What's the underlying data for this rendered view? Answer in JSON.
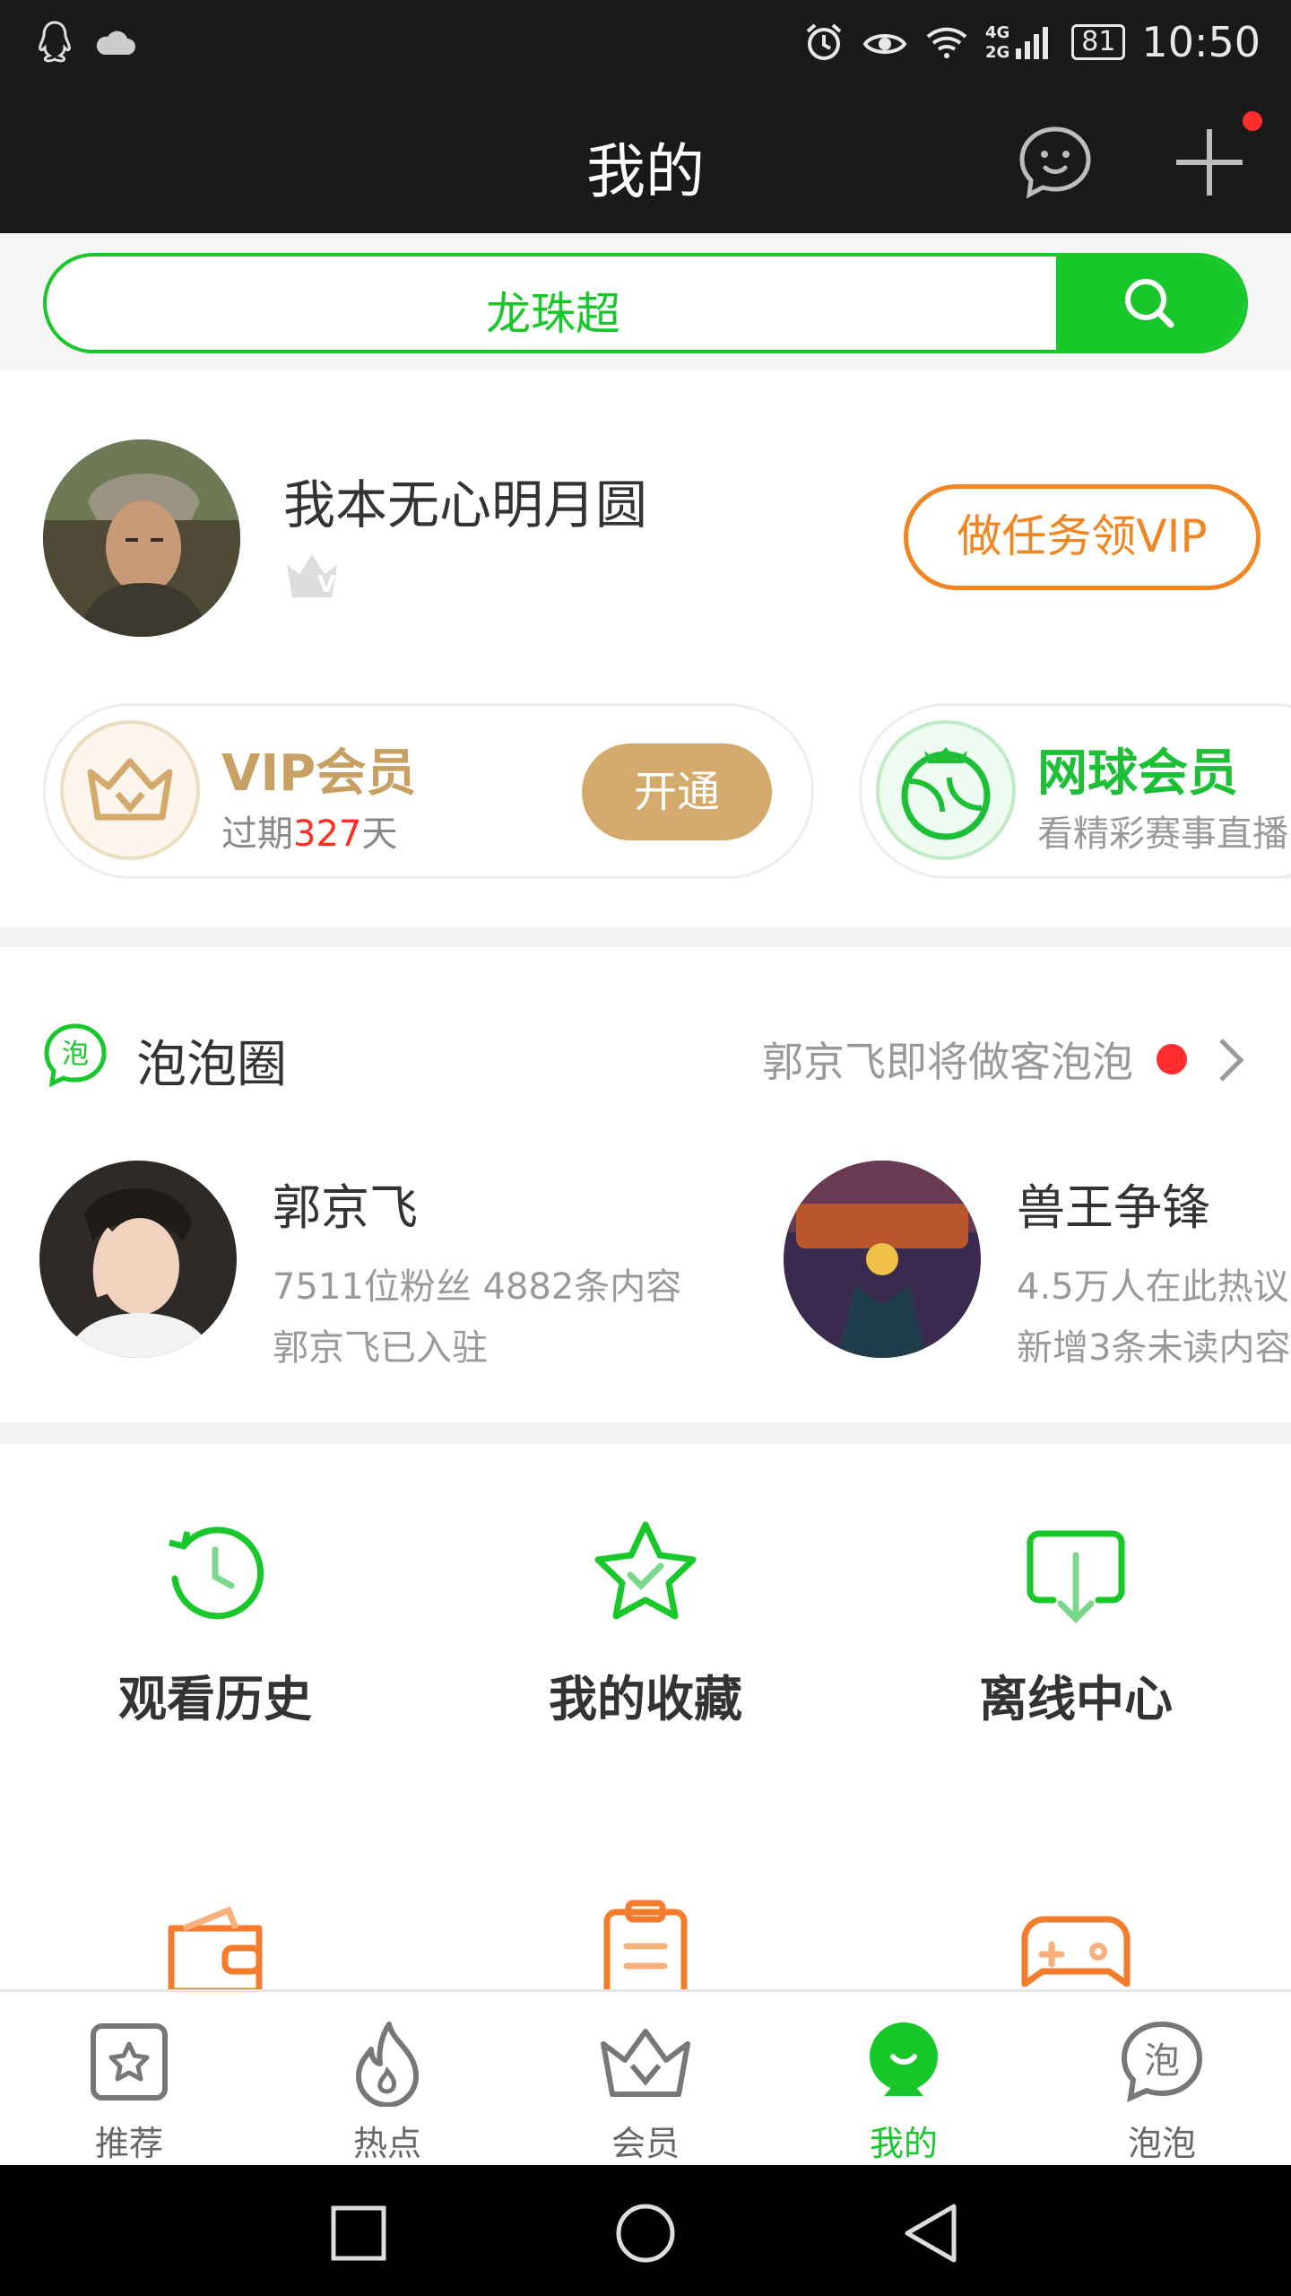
{
  "status_bar": {
    "network": "4G 2G",
    "battery": "81",
    "time": "10:50"
  },
  "header": {
    "title": "我的"
  },
  "search": {
    "placeholder": "龙珠超"
  },
  "profile": {
    "username": "我本无心明月圆",
    "level_badge": "V1",
    "task_button": "做任务领VIP"
  },
  "vip_card": {
    "title": "VIP会员",
    "expiry_prefix": "过期",
    "expiry_days": "327",
    "expiry_suffix": "天",
    "button": "开通"
  },
  "tennis_card": {
    "title": "网球会员",
    "subtitle": "看精彩赛事直播"
  },
  "bubble_circle": {
    "title": "泡泡圈",
    "icon_text": "泡",
    "notice": "郭京飞即将做客泡泡",
    "items": [
      {
        "name": "郭京飞",
        "stats": "7511位粉丝 4882条内容",
        "note": "郭京飞已入驻"
      },
      {
        "name": "兽王争锋",
        "stats": "4.5万人在此热议",
        "note": "新增3条未读内容"
      }
    ]
  },
  "quick_actions": [
    {
      "label": "观看历史",
      "icon": "history-icon"
    },
    {
      "label": "我的收藏",
      "icon": "favorite-star-icon"
    },
    {
      "label": "离线中心",
      "icon": "download-icon"
    }
  ],
  "tabs": [
    {
      "label": "推荐",
      "icon": "star-square-icon",
      "active": false
    },
    {
      "label": "热点",
      "icon": "flame-icon",
      "active": false
    },
    {
      "label": "会员",
      "icon": "crown-icon",
      "active": false
    },
    {
      "label": "我的",
      "icon": "me-icon",
      "active": true
    },
    {
      "label": "泡泡",
      "icon": "bubble-icon",
      "active": false
    }
  ],
  "colors": {
    "accent_green": "#18c72a",
    "vip_gold": "#d3a96c",
    "task_orange": "#f08521",
    "alert_red": "#ff2d2d"
  }
}
